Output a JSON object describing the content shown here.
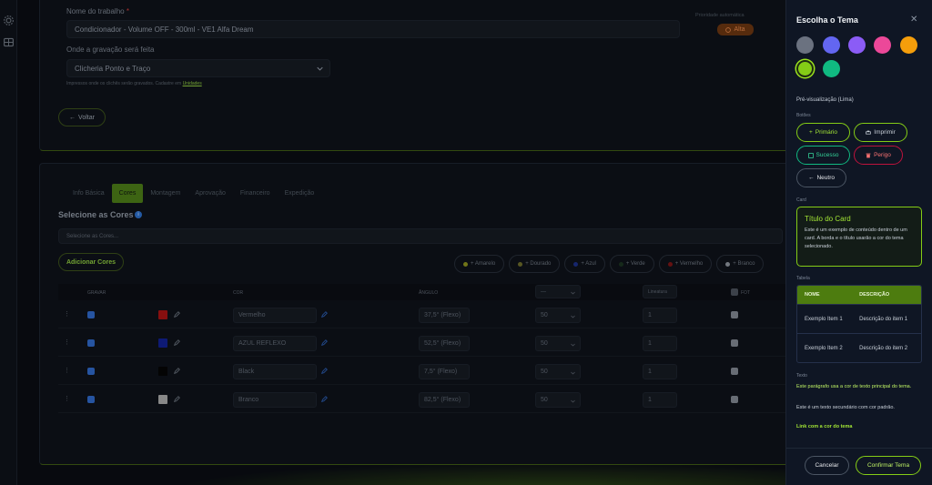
{
  "colors": {
    "accent": "#84cc16",
    "accent_dark": "#4d7c0f",
    "danger": "#e11d48",
    "success": "#10b981"
  },
  "form": {
    "job_name_label": "Nome do trabalho",
    "job_name_required": "*",
    "job_name_value": "Condicionador - Volume OFF - 300ml - VE1 Alfa Dream",
    "priority_label": "Prioridade automática",
    "priority_value": "Alta",
    "location_label": "Onde a gravação será feita",
    "location_value": "Clicheria Ponto e Traço",
    "location_help": "Impressos onde os clichês serão gravados. Cadastre em",
    "location_help_link": "Unidades",
    "back_label": "Voltar"
  },
  "tabs": [
    "Info Básica",
    "Cores",
    "Montagem",
    "Aprovação",
    "Financeiro",
    "Expedição"
  ],
  "active_tab": "Cores",
  "colors_section": {
    "title": "Selecione as Cores",
    "search_placeholder": "Selecione as Cores...",
    "add_button": "Adicionar Cores",
    "chips": [
      {
        "label": "+ Amarelo",
        "color": "#8a8f1e"
      },
      {
        "label": "+ Dourado",
        "color": "#6b6a2a"
      },
      {
        "label": "+ Azul",
        "color": "#1c2f86"
      },
      {
        "label": "+ Verde",
        "color": "#1b3320"
      },
      {
        "label": "+ Vermelho",
        "color": "#7a1515"
      },
      {
        "label": "+ Branco",
        "color": "#8d939b"
      }
    ]
  },
  "table": {
    "headers": {
      "gravar": "GRAVAR",
      "cor": "COR",
      "angulo": "ÂNGULO",
      "lpi_placeholder": "—",
      "lpi_all_placeholder": "Lineatura",
      "fot": "FOT"
    },
    "rows": [
      {
        "swatch": "#a51313",
        "color_name": "Vermelho",
        "angle": "37,5° (Flexo)",
        "lpi": "50",
        "qty": "1"
      },
      {
        "swatch": "#12208f",
        "color_name": "AZUL REFLEXO",
        "angle": "52,5° (Flexo)",
        "lpi": "50",
        "qty": "1"
      },
      {
        "swatch": "#050505",
        "color_name": "Black",
        "angle": "7,5° (Flexo)",
        "lpi": "50",
        "qty": "1"
      },
      {
        "swatch": "#a6a6a6",
        "color_name": "Branco",
        "angle": "82,5° (Flexo)",
        "lpi": "50",
        "qty": "1"
      }
    ]
  },
  "panel": {
    "title": "Escolha o Tema",
    "swatches": [
      "#6b7280",
      "#6366f1",
      "#8b5cf6",
      "#ec4899",
      "#f59e0b",
      "#84cc16",
      "#10b981"
    ],
    "preview_label": "Pré-visualização (Lima)",
    "buttons_label": "Botões",
    "btn_primary": "Primário",
    "btn_print": "Imprimir",
    "btn_success": "Sucesso",
    "btn_danger": "Perigo",
    "btn_neutral": "Neutro",
    "card_label": "Card",
    "card_title": "Título do Card",
    "card_text": "Este é um exemplo de conteúdo dentro de um card. A borda e o título usarão a cor do tema selecionado.",
    "table_label": "Tabela",
    "table_headers": [
      "NOME",
      "DESCRIÇÃO"
    ],
    "table_rows": [
      [
        "Exemplo Item 1",
        "Descrição do item 1"
      ],
      [
        "Exemplo Item 2",
        "Descrição do item 2"
      ]
    ],
    "text_label": "Texto",
    "text_primary": "Este parágrafo usa a cor de texto principal do tema.",
    "text_secondary": "Este é um texto secundário com cor padrão.",
    "text_link": "Link com a cor do tema",
    "cancel": "Cancelar",
    "confirm": "Confirmar Tema"
  }
}
